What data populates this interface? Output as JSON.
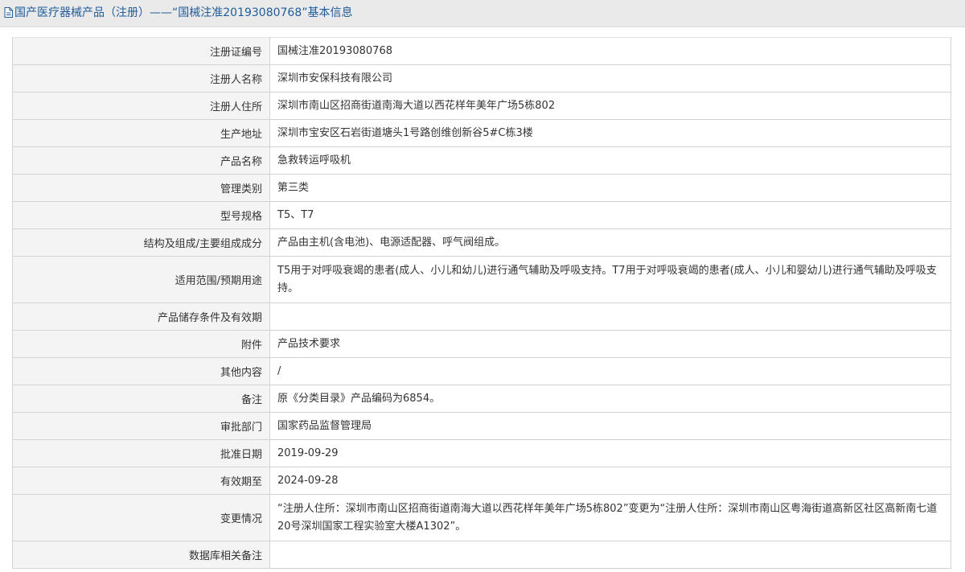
{
  "header": {
    "title": "国产医疗器械产品（注册）——“国械注准20193080768”基本信息"
  },
  "rows": [
    {
      "label": "注册证编号",
      "value": "国械注准20193080768"
    },
    {
      "label": "注册人名称",
      "value": "深圳市安保科技有限公司"
    },
    {
      "label": "注册人住所",
      "value": "深圳市南山区招商街道南海大道以西花样年美年广场5栋802"
    },
    {
      "label": "生产地址",
      "value": "深圳市宝安区石岩街道塘头1号路创维创新谷5#C栋3楼"
    },
    {
      "label": "产品名称",
      "value": "急救转运呼吸机"
    },
    {
      "label": "管理类别",
      "value": "第三类"
    },
    {
      "label": "型号规格",
      "value": "T5、T7"
    },
    {
      "label": "结构及组成/主要组成成分",
      "value": "产品由主机(含电池)、电源适配器、呼气阀组成。"
    },
    {
      "label": "适用范围/预期用途",
      "value": "T5用于对呼吸衰竭的患者(成人、小儿和幼儿)进行通气辅助及呼吸支持。T7用于对呼吸衰竭的患者(成人、小儿和婴幼儿)进行通气辅助及呼吸支持。"
    },
    {
      "label": "产品储存条件及有效期",
      "value": ""
    },
    {
      "label": "附件",
      "value": "产品技术要求"
    },
    {
      "label": "其他内容",
      "value": "/"
    },
    {
      "label": "备注",
      "value": "原《分类目录》产品编码为6854。"
    },
    {
      "label": "审批部门",
      "value": "国家药品监督管理局"
    },
    {
      "label": "批准日期",
      "value": "2019-09-29"
    },
    {
      "label": "有效期至",
      "value": "2024-09-28"
    },
    {
      "label": "变更情况",
      "value": "“注册人住所：深圳市南山区招商街道南海大道以西花样年美年广场5栋802”变更为“注册人住所：深圳市南山区粤海街道高新区社区高新南七道20号深圳国家工程实验室大楼A1302”。"
    },
    {
      "label": "数据库相关备注",
      "value": ""
    }
  ]
}
